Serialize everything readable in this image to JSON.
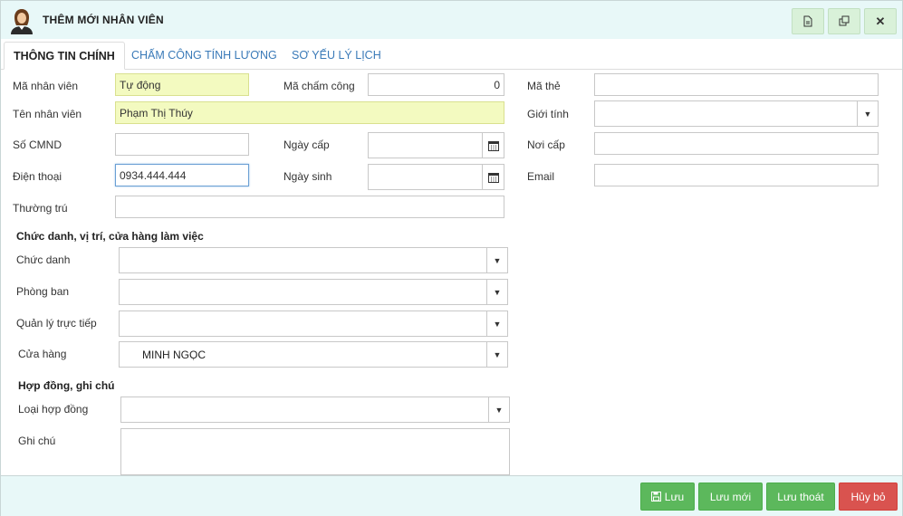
{
  "window": {
    "title": "THÊM MỚI NHÂN VIÊN"
  },
  "tabs": [
    {
      "label": "THÔNG TIN CHÍNH"
    },
    {
      "label": "CHẤM CÔNG TÍNH LƯƠNG"
    },
    {
      "label": "SƠ YẾU LÝ LỊCH"
    }
  ],
  "form": {
    "ma_nhan_vien": {
      "label": "Mã nhân viên",
      "value": "Tự động"
    },
    "ma_cham_cong": {
      "label": "Mã chấm công",
      "value": "0"
    },
    "ma_the": {
      "label": "Mã thẻ",
      "value": ""
    },
    "ten_nhan_vien": {
      "label": "Tên nhân viên",
      "value": "Phạm Thị Thúy"
    },
    "gioi_tinh": {
      "label": "Giới tính",
      "value": ""
    },
    "so_cmnd": {
      "label": "Số CMND",
      "value": ""
    },
    "ngay_cap": {
      "label": "Ngày cấp",
      "value": ""
    },
    "noi_cap": {
      "label": "Nơi cấp",
      "value": ""
    },
    "dien_thoai": {
      "label": "Điện thoại",
      "value": "0934.444.444"
    },
    "ngay_sinh": {
      "label": "Ngày sinh",
      "value": ""
    },
    "email": {
      "label": "Email",
      "value": ""
    },
    "thuong_tru": {
      "label": "Thường trú",
      "value": ""
    }
  },
  "section_position": {
    "title": "Chức danh, vị trí, cửa hàng làm việc",
    "chuc_danh": {
      "label": "Chức danh",
      "value": ""
    },
    "phong_ban": {
      "label": "Phòng ban",
      "value": ""
    },
    "quan_ly": {
      "label": "Quản lý trực tiếp",
      "value": ""
    },
    "cua_hang": {
      "label": "Cửa hàng",
      "value": "MINH NGỌC"
    }
  },
  "section_contract": {
    "title": "Hợp đồng, ghi chú",
    "loai_hop_dong": {
      "label": "Loại hợp đồng",
      "value": ""
    },
    "ghi_chu": {
      "label": "Ghi chú",
      "value": ""
    }
  },
  "footer": {
    "save": "Lưu",
    "save_new": "Lưu mới",
    "save_exit": "Lưu thoát",
    "cancel": "Hủy bỏ"
  },
  "icons": {
    "avatar": "user-avatar-icon",
    "doc": "document-icon",
    "restore": "restore-window-icon",
    "close": "close-icon",
    "calendar": "calendar-icon",
    "dropdown": "chevron-down-icon",
    "save": "floppy-disk-icon"
  },
  "colors": {
    "header_bg": "#e8f8f8",
    "highlight_input": "#f3fac0",
    "tab_link": "#3a7ab8",
    "button_green": "#5cb85c",
    "button_red": "#d9534f"
  }
}
